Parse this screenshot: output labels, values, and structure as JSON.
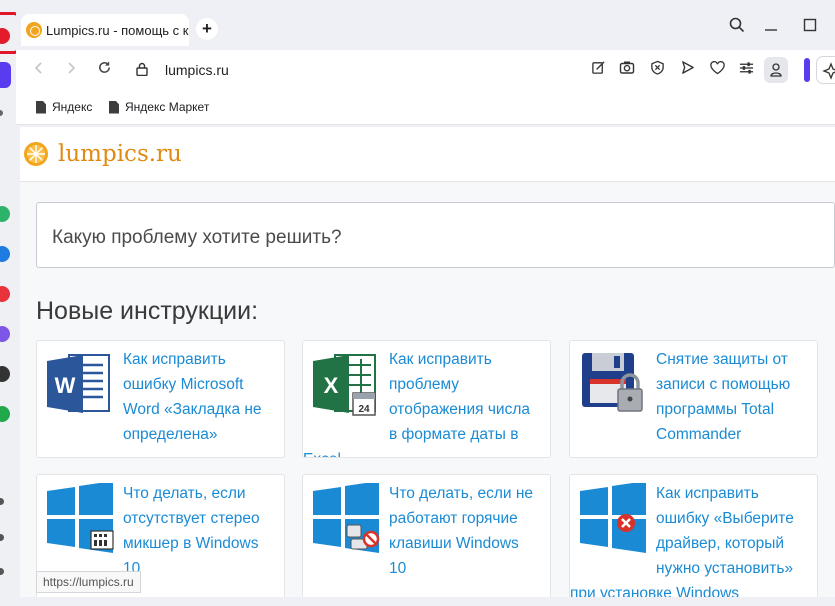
{
  "tab": {
    "title": "Lumpics.ru - помощь с ко"
  },
  "address": {
    "url": "lumpics.ru"
  },
  "bookmarks": [
    {
      "label": "Яндекс"
    },
    {
      "label": "Яндекс Маркет"
    }
  ],
  "site": {
    "name": "lumpics.ru",
    "search_placeholder": "Какую проблему хотите решить?",
    "section_title": "Новые инструкции:"
  },
  "articles": [
    {
      "title": "Как исправить ошибку Microsoft Word «Закладка не определена»",
      "icon": "word-icon"
    },
    {
      "title": "Как исправить проблему отображения числа в формате даты в Excel",
      "icon": "excel-icon"
    },
    {
      "title": "Снятие защиты от записи с помощью программы Total Commander",
      "icon": "floppy-lock-icon"
    },
    {
      "title": "Что делать, если отсутствует стерео микшер в Windows 10",
      "icon": "windows-mixer-icon"
    },
    {
      "title": "Что делать, если не работают горячие клавиши Windows 10",
      "icon": "windows-keys-icon"
    },
    {
      "title": "Как исправить ошибку «Выберите драйвер, который нужно установить» при установке Windows",
      "icon": "windows-error-icon"
    }
  ],
  "status": {
    "url": "https://lumpics.ru"
  },
  "colors": {
    "accent": "#5a3cf0",
    "link": "#1a8bd4",
    "brand": "#e08a12",
    "highlight": "#e0162b"
  }
}
